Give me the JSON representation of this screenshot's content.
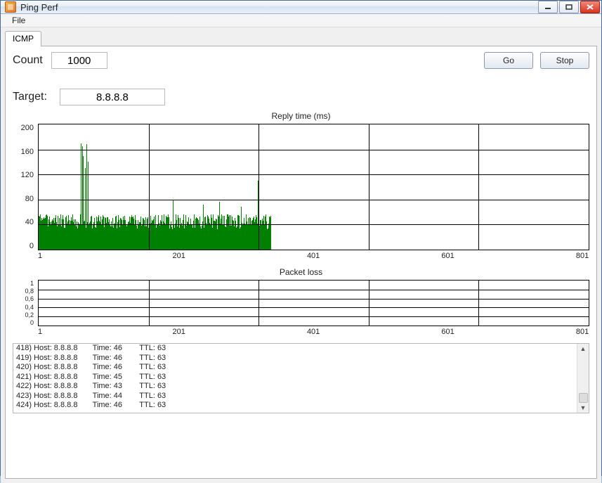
{
  "window": {
    "title": "Ping Perf"
  },
  "menu": {
    "file": "File"
  },
  "tabs": {
    "icmp": "ICMP"
  },
  "controls": {
    "count_label": "Count",
    "count_value": "1000",
    "target_label": "Target:",
    "target_value": "8.8.8.8",
    "go": "Go",
    "stop": "Stop"
  },
  "chart_data": [
    {
      "type": "bar",
      "title": "Reply time (ms)",
      "xlabel": "",
      "ylabel": "",
      "xlim": [
        1,
        1000
      ],
      "ylim": [
        0,
        200
      ],
      "x_ticks": [
        "1",
        "201",
        "401",
        "601",
        "801"
      ],
      "y_ticks": [
        "0",
        "40",
        "80",
        "120",
        "160",
        "200"
      ],
      "series": [
        {
          "name": "reply_ms",
          "x_range": [
            1,
            424
          ],
          "baseline": 40,
          "noise": 12,
          "spikes": [
            {
              "x": 78,
              "v": 170
            },
            {
              "x": 80,
              "v": 165
            },
            {
              "x": 82,
              "v": 150
            },
            {
              "x": 85,
              "v": 130
            },
            {
              "x": 88,
              "v": 168
            },
            {
              "x": 90,
              "v": 140
            },
            {
              "x": 245,
              "v": 80
            },
            {
              "x": 300,
              "v": 72
            },
            {
              "x": 330,
              "v": 76
            },
            {
              "x": 370,
              "v": 68
            },
            {
              "x": 400,
              "v": 110
            },
            {
              "x": 402,
              "v": 98
            }
          ]
        }
      ]
    },
    {
      "type": "bar",
      "title": "Packet loss",
      "xlabel": "",
      "ylabel": "",
      "xlim": [
        1,
        1000
      ],
      "ylim": [
        0,
        1
      ],
      "x_ticks": [
        "1",
        "201",
        "401",
        "601",
        "801"
      ],
      "y_ticks": [
        "0",
        "0,2",
        "0,4",
        "0,6",
        "0,8",
        "1"
      ],
      "series": [
        {
          "name": "loss",
          "x_range": [
            1,
            424
          ],
          "values_all_zero": true
        }
      ]
    }
  ],
  "log": {
    "lines": [
      {
        "idx": 418,
        "host": "8.8.8.8",
        "time": 46,
        "ttl": 63
      },
      {
        "idx": 419,
        "host": "8.8.8.8",
        "time": 46,
        "ttl": 63
      },
      {
        "idx": 420,
        "host": "8.8.8.8",
        "time": 46,
        "ttl": 63
      },
      {
        "idx": 421,
        "host": "8.8.8.8",
        "time": 45,
        "ttl": 63
      },
      {
        "idx": 422,
        "host": "8.8.8.8",
        "time": 43,
        "ttl": 63
      },
      {
        "idx": 423,
        "host": "8.8.8.8",
        "time": 44,
        "ttl": 63
      },
      {
        "idx": 424,
        "host": "8.8.8.8",
        "time": 46,
        "ttl": 63
      }
    ]
  }
}
